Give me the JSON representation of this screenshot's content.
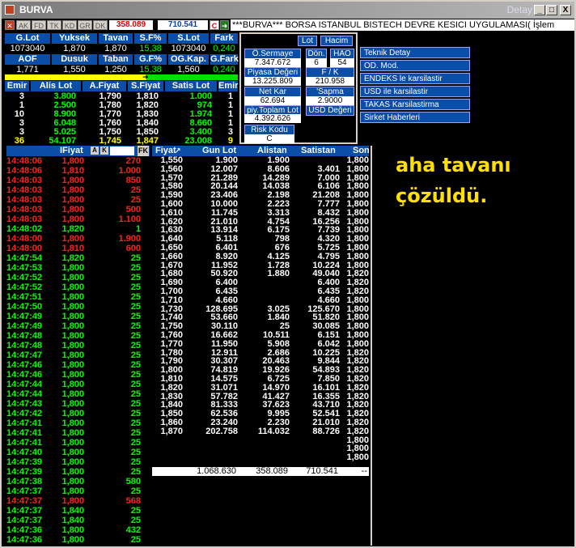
{
  "window": {
    "title": "BURVA",
    "detail": "Detay",
    "min": "_",
    "max": "□",
    "close": "X"
  },
  "toolbar": {
    "tabs": [
      "AK",
      "FD",
      "TK",
      "KD",
      "GR",
      "DK"
    ],
    "value1": "358.089",
    "value2": "710.541",
    "c_label": "C",
    "marquee": "***BURVA*** BORSA ISTANBUL BISTECH DEVRE KESICI UYGULAMASI( İşlem"
  },
  "summary": {
    "row1_headers": [
      "G.Lot",
      "Yuksek",
      "Tavan",
      "S.F%",
      "S.Lot",
      "Fark"
    ],
    "row1_values": [
      "1073040",
      "1,870",
      "1,870",
      "15,38",
      "1073040",
      "0,240"
    ],
    "row2_headers": [
      "AOF",
      "Dusuk",
      "Taban",
      "G.F%",
      "OG.Kap.",
      "G.Fark"
    ],
    "row2_values": [
      "1,771",
      "1,550",
      "1,250",
      "15,38",
      "1,560",
      "0,240"
    ]
  },
  "orderbook": {
    "headers": [
      "Emir",
      "Alis Lot",
      "A.Fiyat",
      "S.Fiyat",
      "Satis Lot",
      "Emir"
    ],
    "rows": [
      [
        "3",
        "3.800",
        "1,790",
        "1,810",
        "1.000",
        "1"
      ],
      [
        "1",
        "2.500",
        "1,780",
        "1,820",
        "974",
        "1"
      ],
      [
        "10",
        "8.900",
        "1,770",
        "1,830",
        "1.974",
        "1"
      ],
      [
        "3",
        "6.048",
        "1,760",
        "1,840",
        "8.660",
        "1"
      ],
      [
        "3",
        "5.025",
        "1,750",
        "1,850",
        "3.400",
        "3"
      ],
      [
        "36",
        "54.107",
        "1,745",
        "1,847",
        "23.008",
        "9"
      ]
    ]
  },
  "panel": {
    "lot": "Lot",
    "hacim": "Hacim",
    "o_sermaye": "Ö.Sermaye",
    "o_sermaye_val": "7.347.672",
    "don": "Dön.",
    "don_val": "6",
    "hao": "HAO",
    "hao_val": "54",
    "piyasa": "Piyasa Değeri",
    "piyasa_val": "13.225.809",
    "fk": "F / K",
    "fk_val": "210.958",
    "netkar": "Net Kar",
    "netkar_val": "62.694",
    "sapma": "'Sapma",
    "sapma_val": "2.9000",
    "piy_toplam": "piy.Toplam Lot",
    "piy_toplam_val": "4.392.626",
    "usd": "USD Değeri",
    "risk": "Risk Kodu",
    "risk_val": "C"
  },
  "right_buttons": [
    "Teknik Detay",
    "OD. Mod.",
    "ENDEKS le karsilastir",
    "USD ile karsilastir",
    "TAKAS Karsilastirma",
    "Sirket Haberleri"
  ],
  "overlay_text": [
    "aha tavanı",
    "çözüldü."
  ],
  "trades": {
    "headers": [
      "IFiyat",
      "A",
      "K",
      "FK"
    ],
    "rows": [
      [
        "14:48:06",
        "1,800",
        "270",
        "red"
      ],
      [
        "14:48:06",
        "1,810",
        "1.000",
        "red"
      ],
      [
        "14:48:03",
        "1,800",
        "850",
        "red"
      ],
      [
        "14:48:03",
        "1,800",
        "25",
        "red"
      ],
      [
        "14:48:03",
        "1,800",
        "25",
        "red"
      ],
      [
        "14:48:03",
        "1,800",
        "500",
        "red"
      ],
      [
        "14:48:03",
        "1,800",
        "1.100",
        "red"
      ],
      [
        "14:48:02",
        "1,820",
        "1",
        "green"
      ],
      [
        "14:48:00",
        "1,800",
        "1.900",
        "red"
      ],
      [
        "14:48:00",
        "1,810",
        "600",
        "red"
      ],
      [
        "14:47:54",
        "1,820",
        "25",
        "green"
      ],
      [
        "14:47:53",
        "1,800",
        "25",
        "green"
      ],
      [
        "14:47:52",
        "1,800",
        "25",
        "green"
      ],
      [
        "14:47:52",
        "1,800",
        "25",
        "green"
      ],
      [
        "14:47:51",
        "1,800",
        "25",
        "green"
      ],
      [
        "14:47:50",
        "1,800",
        "25",
        "green"
      ],
      [
        "14:47:49",
        "1,800",
        "25",
        "green"
      ],
      [
        "14:47:49",
        "1,800",
        "25",
        "green"
      ],
      [
        "14:47:48",
        "1,800",
        "25",
        "green"
      ],
      [
        "14:47:48",
        "1,800",
        "25",
        "green"
      ],
      [
        "14:47:47",
        "1,800",
        "25",
        "green"
      ],
      [
        "14:47:46",
        "1,800",
        "25",
        "green"
      ],
      [
        "14:47:46",
        "1,800",
        "25",
        "green"
      ],
      [
        "14:47:44",
        "1,800",
        "25",
        "green"
      ],
      [
        "14:47:44",
        "1,800",
        "25",
        "green"
      ],
      [
        "14:47:43",
        "1,800",
        "25",
        "green"
      ],
      [
        "14:47:42",
        "1,800",
        "25",
        "green"
      ],
      [
        "14:47:41",
        "1,800",
        "25",
        "green"
      ],
      [
        "14:47:41",
        "1,800",
        "25",
        "green"
      ],
      [
        "14:47:41",
        "1,800",
        "25",
        "green"
      ],
      [
        "14:47:40",
        "1,800",
        "25",
        "green"
      ],
      [
        "14:47:39",
        "1,800",
        "25",
        "green"
      ],
      [
        "14:47:39",
        "1,800",
        "25",
        "green"
      ],
      [
        "14:47:38",
        "1,800",
        "580",
        "green"
      ],
      [
        "14:47:37",
        "1,800",
        "25",
        "green"
      ],
      [
        "14:47:37",
        "1,800",
        "568",
        "red"
      ],
      [
        "14:47:37",
        "1,840",
        "25",
        "green"
      ],
      [
        "14:47:37",
        "1,840",
        "25",
        "green"
      ],
      [
        "14:47:36",
        "1,800",
        "432",
        "green"
      ],
      [
        "14:47:36",
        "1,800",
        "25",
        "green"
      ]
    ]
  },
  "depth": {
    "headers": [
      "Fiyat",
      "Gun Lot",
      "Alistan",
      "Satistan",
      "Son"
    ],
    "rows": [
      [
        "1,550",
        "1.900",
        "1.900",
        "",
        "1,800"
      ],
      [
        "1,560",
        "12.007",
        "8.606",
        "3.401",
        "1,800"
      ],
      [
        "1,570",
        "21.289",
        "14.289",
        "7.000",
        "1,800"
      ],
      [
        "1,580",
        "20.144",
        "14.038",
        "6.106",
        "1,800"
      ],
      [
        "1,590",
        "23.406",
        "2.198",
        "21.208",
        "1,800"
      ],
      [
        "1,600",
        "10.000",
        "2.223",
        "7.777",
        "1,800"
      ],
      [
        "1,610",
        "11.745",
        "3.313",
        "8.432",
        "1,800"
      ],
      [
        "1,620",
        "21.010",
        "4.754",
        "16.256",
        "1,800"
      ],
      [
        "1,630",
        "13.914",
        "6.175",
        "7.739",
        "1,800"
      ],
      [
        "1,640",
        "5.118",
        "798",
        "4.320",
        "1,800"
      ],
      [
        "1,650",
        "6.401",
        "676",
        "5.725",
        "1,800"
      ],
      [
        "1,660",
        "8.920",
        "4.125",
        "4.795",
        "1,800"
      ],
      [
        "1,670",
        "11.952",
        "1.728",
        "10.224",
        "1,800"
      ],
      [
        "1,680",
        "50.920",
        "1.880",
        "49.040",
        "1,820"
      ],
      [
        "1,690",
        "6.400",
        "",
        "6.400",
        "1,820"
      ],
      [
        "1,700",
        "6.435",
        "",
        "6.435",
        "1,820"
      ],
      [
        "1,710",
        "4.660",
        "",
        "4.660",
        "1,800"
      ],
      [
        "1,730",
        "128.695",
        "3.025",
        "125.670",
        "1,800"
      ],
      [
        "1,740",
        "53.660",
        "1.840",
        "51.820",
        "1,800"
      ],
      [
        "1,750",
        "30.110",
        "25",
        "30.085",
        "1,800"
      ],
      [
        "1,760",
        "16.662",
        "10.511",
        "6.151",
        "1,800"
      ],
      [
        "1,770",
        "11.950",
        "5.908",
        "6.042",
        "1,800"
      ],
      [
        "1,780",
        "12.911",
        "2.686",
        "10.225",
        "1,820"
      ],
      [
        "1,790",
        "30.307",
        "20.463",
        "9.844",
        "1,820"
      ],
      [
        "1,800",
        "74.819",
        "19.926",
        "54.893",
        "1,820"
      ],
      [
        "1,810",
        "14.575",
        "6.725",
        "7.850",
        "1,820"
      ],
      [
        "1,820",
        "31.071",
        "14.970",
        "16.101",
        "1,820"
      ],
      [
        "1,830",
        "57.782",
        "41.427",
        "16.355",
        "1,820"
      ],
      [
        "1,840",
        "81.333",
        "37.623",
        "43.710",
        "1,820"
      ],
      [
        "1,850",
        "62.536",
        "9.995",
        "52.541",
        "1,820"
      ],
      [
        "1,860",
        "23.240",
        "2.230",
        "21.010",
        "1,820"
      ],
      [
        "1,870",
        "202.758",
        "114.032",
        "88.726",
        "1,820"
      ],
      [
        "",
        "",
        "",
        "",
        "1,800"
      ],
      [
        "",
        "",
        "",
        "",
        "1,800"
      ],
      [
        "",
        "",
        "",
        "",
        "1,800"
      ]
    ],
    "totals": [
      "1.068.630",
      "358.089",
      "710.541",
      "--"
    ]
  }
}
